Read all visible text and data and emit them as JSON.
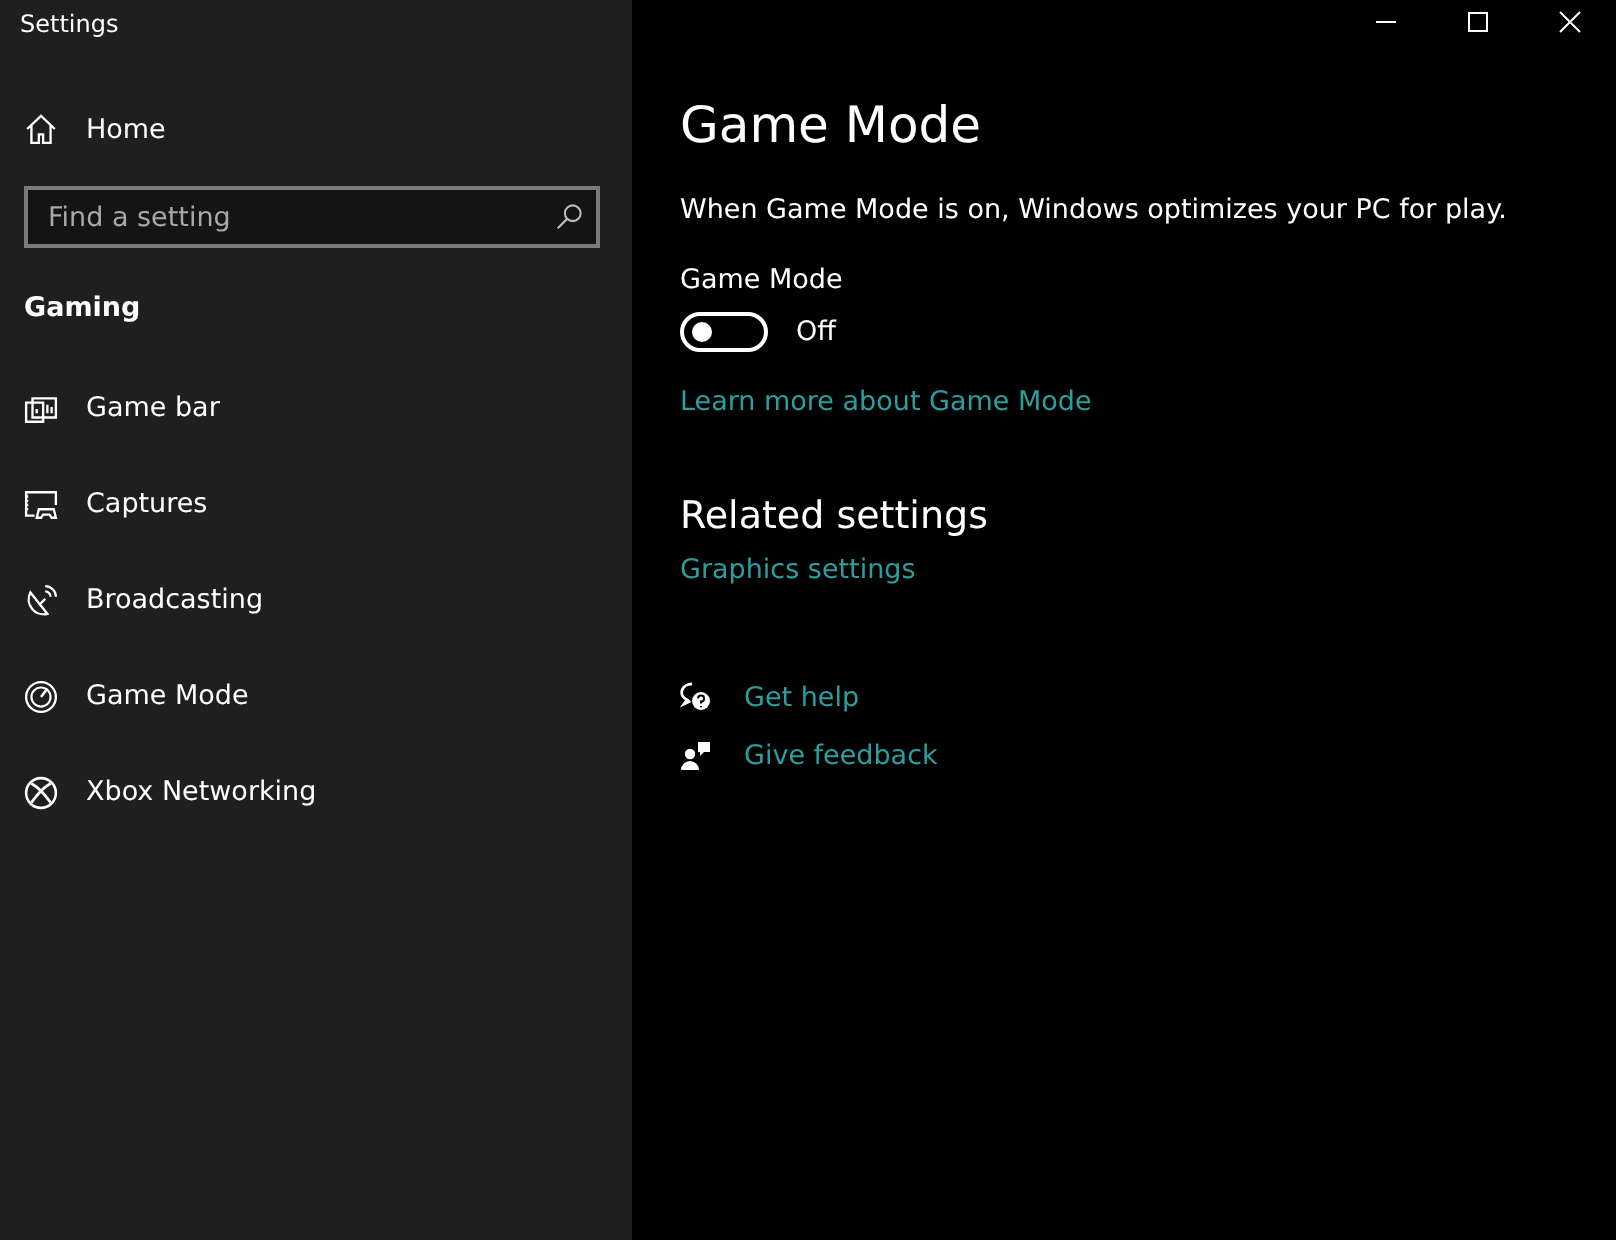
{
  "window": {
    "title": "Settings"
  },
  "sidebar": {
    "home": "Home",
    "search": {
      "placeholder": "Find a setting"
    },
    "section": "Gaming",
    "items": [
      {
        "label": "Game bar",
        "kind": "gamebar"
      },
      {
        "label": "Captures",
        "kind": "captures"
      },
      {
        "label": "Broadcasting",
        "kind": "broadcasting"
      },
      {
        "label": "Game Mode",
        "kind": "gamemode"
      },
      {
        "label": "Xbox Networking",
        "kind": "xbox"
      }
    ]
  },
  "main": {
    "title": "Game Mode",
    "description": "When Game Mode is on, Windows optimizes your PC for play.",
    "toggle": {
      "label": "Game Mode",
      "on": false,
      "state_text": "Off"
    },
    "learn_more": "Learn more about Game Mode",
    "related": {
      "heading": "Related settings",
      "links": [
        "Graphics settings"
      ]
    },
    "support": [
      {
        "label": "Get help",
        "kind": "help"
      },
      {
        "label": "Give feedback",
        "kind": "feedback"
      }
    ]
  }
}
